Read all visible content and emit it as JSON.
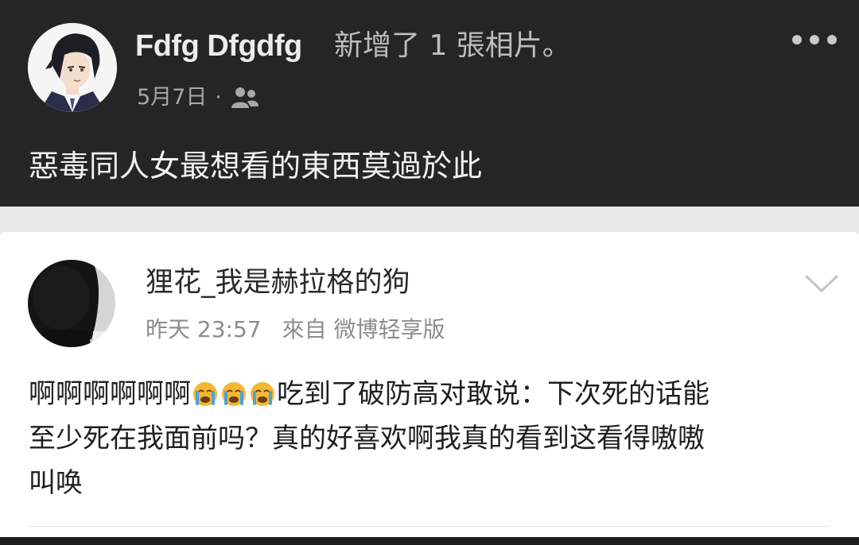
{
  "post": {
    "author": "Fdfg Dfgdfg",
    "action": "新增了 1 張相片。",
    "date": "5月7日",
    "separator": "·",
    "audience_icon": "friends-icon",
    "more_icon": "more-dots-icon",
    "text": "惡毒同人女最想看的東西莫過於此"
  },
  "weibo": {
    "username": "狸花_我是赫拉格的狗",
    "time": "昨天 23:57",
    "source": "來自 微博轻享版",
    "chevron_icon": "chevron-down-icon",
    "emoji_icon": "crying-face-icon",
    "body": {
      "line1_prefix": "啊啊啊啊啊啊",
      "line1_suffix": "吃到了破防高对敢说：下次死的话能",
      "line2": "至少死在我面前吗？真的好喜欢啊我真的看到这看得嗷嗷",
      "line3": "叫唤"
    }
  },
  "colors": {
    "post_background": "#252526",
    "page_background": "#e9e9e9",
    "card_background": "#ffffff",
    "emoji_yellow": "#f5b731",
    "emoji_tears": "#4aa3e0"
  }
}
